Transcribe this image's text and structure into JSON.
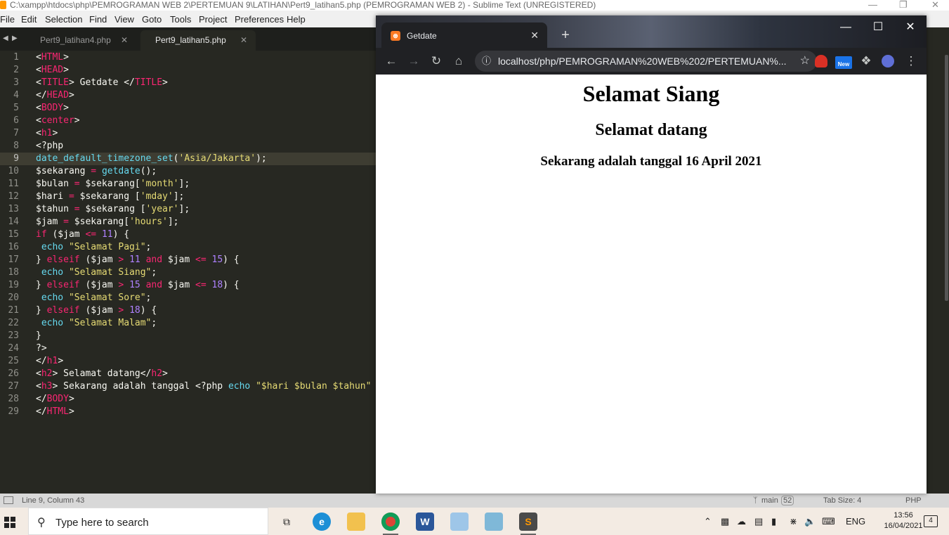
{
  "sublime": {
    "window_title": "C:\\xampp\\htdocs\\php\\PEMROGRAMAN WEB 2\\PERTEMUAN 9\\LATIHAN\\Pert9_latihan5.php (PEMROGRAMAN WEB 2) - Sublime Text (UNREGISTERED)",
    "menu": [
      "File",
      "Edit",
      "Selection",
      "Find",
      "View",
      "Goto",
      "Tools",
      "Project",
      "Preferences",
      "Help"
    ],
    "tabs": [
      {
        "label": "Pert9_latihan4.php",
        "active": false
      },
      {
        "label": "Pert9_latihan5.php",
        "active": true
      }
    ],
    "current_line": 9,
    "lines": [
      {
        "n": "1"
      },
      {
        "n": "2"
      },
      {
        "n": "3"
      },
      {
        "n": "4"
      },
      {
        "n": "5"
      },
      {
        "n": "6"
      },
      {
        "n": "7"
      },
      {
        "n": "8"
      },
      {
        "n": "9"
      },
      {
        "n": "10"
      },
      {
        "n": "11"
      },
      {
        "n": "12"
      },
      {
        "n": "13"
      },
      {
        "n": "14"
      },
      {
        "n": "15"
      },
      {
        "n": "16"
      },
      {
        "n": "17"
      },
      {
        "n": "18"
      },
      {
        "n": "19"
      },
      {
        "n": "20"
      },
      {
        "n": "21"
      },
      {
        "n": "22"
      },
      {
        "n": "23"
      },
      {
        "n": "24"
      },
      {
        "n": "25"
      },
      {
        "n": "26"
      },
      {
        "n": "27"
      },
      {
        "n": "28"
      },
      {
        "n": "29"
      }
    ],
    "code_tokens": [
      [
        [
          "p",
          "<"
        ],
        [
          "k",
          "HTML"
        ],
        [
          "p",
          ">"
        ]
      ],
      [
        [
          "p",
          "<"
        ],
        [
          "k",
          "HEAD"
        ],
        [
          "p",
          ">"
        ]
      ],
      [
        [
          "p",
          "<"
        ],
        [
          "k",
          "TITLE"
        ],
        [
          "p",
          "> Getdate </"
        ],
        [
          "k",
          "TITLE"
        ],
        [
          "p",
          ">"
        ]
      ],
      [
        [
          "p",
          "</"
        ],
        [
          "k",
          "HEAD"
        ],
        [
          "p",
          ">"
        ]
      ],
      [
        [
          "p",
          "<"
        ],
        [
          "k",
          "BODY"
        ],
        [
          "p",
          ">"
        ]
      ],
      [
        [
          "p",
          "<"
        ],
        [
          "k",
          "center"
        ],
        [
          "p",
          ">"
        ]
      ],
      [
        [
          "p",
          "<"
        ],
        [
          "k",
          "h1"
        ],
        [
          "p",
          ">"
        ]
      ],
      [
        [
          "p",
          "<?php"
        ]
      ],
      [
        [
          "f",
          "date_default_timezone_set"
        ],
        [
          "p",
          "("
        ],
        [
          "s",
          "'Asia/Jakarta'"
        ],
        [
          "p",
          ");"
        ]
      ],
      [
        [
          "p",
          "$sekarang "
        ],
        [
          "k",
          "="
        ],
        [
          "p",
          " "
        ],
        [
          "f",
          "getdate"
        ],
        [
          "p",
          "();"
        ]
      ],
      [
        [
          "p",
          "$bulan "
        ],
        [
          "k",
          "="
        ],
        [
          "p",
          " $sekarang["
        ],
        [
          "s",
          "'month'"
        ],
        [
          "p",
          "];"
        ]
      ],
      [
        [
          "p",
          "$hari "
        ],
        [
          "k",
          "="
        ],
        [
          "p",
          " $sekarang ["
        ],
        [
          "s",
          "'mday'"
        ],
        [
          "p",
          "];"
        ]
      ],
      [
        [
          "p",
          "$tahun "
        ],
        [
          "k",
          "="
        ],
        [
          "p",
          " $sekarang ["
        ],
        [
          "s",
          "'year'"
        ],
        [
          "p",
          "];"
        ]
      ],
      [
        [
          "p",
          "$jam "
        ],
        [
          "k",
          "="
        ],
        [
          "p",
          " $sekarang["
        ],
        [
          "s",
          "'hours'"
        ],
        [
          "p",
          "];"
        ]
      ],
      [
        [
          "k",
          "if"
        ],
        [
          "p",
          " ($jam "
        ],
        [
          "k",
          "<="
        ],
        [
          "p",
          " "
        ],
        [
          "n",
          "11"
        ],
        [
          "p",
          ") {"
        ]
      ],
      [
        [
          "p",
          " "
        ],
        [
          "f",
          "echo"
        ],
        [
          "p",
          " "
        ],
        [
          "s",
          "\"Selamat Pagi\""
        ],
        [
          "p",
          ";"
        ]
      ],
      [
        [
          "p",
          "} "
        ],
        [
          "k",
          "elseif"
        ],
        [
          "p",
          " ($jam "
        ],
        [
          "k",
          ">"
        ],
        [
          "p",
          " "
        ],
        [
          "n",
          "11"
        ],
        [
          "p",
          " "
        ],
        [
          "k",
          "and"
        ],
        [
          "p",
          " $jam "
        ],
        [
          "k",
          "<="
        ],
        [
          "p",
          " "
        ],
        [
          "n",
          "15"
        ],
        [
          "p",
          ") {"
        ]
      ],
      [
        [
          "p",
          " "
        ],
        [
          "f",
          "echo"
        ],
        [
          "p",
          " "
        ],
        [
          "s",
          "\"Selamat Siang\""
        ],
        [
          "p",
          ";"
        ]
      ],
      [
        [
          "p",
          "} "
        ],
        [
          "k",
          "elseif"
        ],
        [
          "p",
          " ($jam "
        ],
        [
          "k",
          ">"
        ],
        [
          "p",
          " "
        ],
        [
          "n",
          "15"
        ],
        [
          "p",
          " "
        ],
        [
          "k",
          "and"
        ],
        [
          "p",
          " $jam "
        ],
        [
          "k",
          "<="
        ],
        [
          "p",
          " "
        ],
        [
          "n",
          "18"
        ],
        [
          "p",
          ") {"
        ]
      ],
      [
        [
          "p",
          " "
        ],
        [
          "f",
          "echo"
        ],
        [
          "p",
          " "
        ],
        [
          "s",
          "\"Selamat Sore\""
        ],
        [
          "p",
          ";"
        ]
      ],
      [
        [
          "p",
          "} "
        ],
        [
          "k",
          "elseif"
        ],
        [
          "p",
          " ($jam "
        ],
        [
          "k",
          ">"
        ],
        [
          "p",
          " "
        ],
        [
          "n",
          "18"
        ],
        [
          "p",
          ") {"
        ]
      ],
      [
        [
          "p",
          " "
        ],
        [
          "f",
          "echo"
        ],
        [
          "p",
          " "
        ],
        [
          "s",
          "\"Selamat Malam\""
        ],
        [
          "p",
          ";"
        ]
      ],
      [
        [
          "p",
          "}"
        ]
      ],
      [
        [
          "p",
          "?>"
        ]
      ],
      [
        [
          "p",
          "</"
        ],
        [
          "k",
          "h1"
        ],
        [
          "p",
          ">"
        ]
      ],
      [
        [
          "p",
          "<"
        ],
        [
          "k",
          "h2"
        ],
        [
          "p",
          "> Selamat datang</"
        ],
        [
          "k",
          "h2"
        ],
        [
          "p",
          ">"
        ]
      ],
      [
        [
          "p",
          "<"
        ],
        [
          "k",
          "h3"
        ],
        [
          "p",
          "> Sekarang adalah tanggal <?php "
        ],
        [
          "f",
          "echo"
        ],
        [
          "p",
          " "
        ],
        [
          "s",
          "\"$hari $bulan $tahun\""
        ]
      ],
      [
        [
          "p",
          "</"
        ],
        [
          "k",
          "BODY"
        ],
        [
          "p",
          ">"
        ]
      ],
      [
        [
          "p",
          "</"
        ],
        [
          "k",
          "HTML"
        ],
        [
          "p",
          ">"
        ]
      ]
    ],
    "status": {
      "position": "Line 9, Column 43",
      "branch": "main",
      "branch_count": "52",
      "tab_size": "Tab Size: 4",
      "syntax": "PHP"
    }
  },
  "chrome": {
    "tab_title": "Getdate",
    "url": "localhost/php/PEMROGRAMAN%20WEB%202/PERTEMUAN%...",
    "ext_new_label": "New",
    "page": {
      "h1": "Selamat Siang",
      "h2": "Selamat datang",
      "h3": "Sekarang adalah tanggal 16 April 2021"
    }
  },
  "taskbar": {
    "search_placeholder": "Type here to search",
    "language": "ENG",
    "time": "13:56",
    "date": "16/04/2021",
    "notification_count": "4"
  },
  "colors": {
    "editor_bg": "#272822",
    "keyword": "#f92672",
    "string": "#e6db74",
    "function": "#66d9ef",
    "number": "#ae81ff"
  }
}
